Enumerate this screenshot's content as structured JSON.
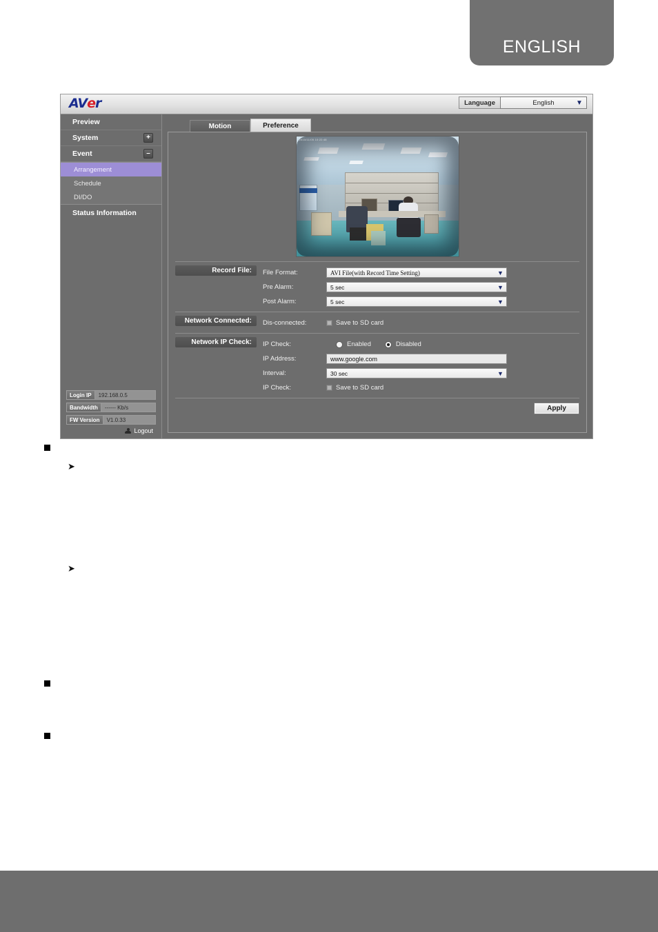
{
  "page": {
    "language_banner": "ENGLISH"
  },
  "app": {
    "logo": {
      "part1": "AV",
      "swirl": "e",
      "part2": "r"
    },
    "language": {
      "label": "Language",
      "selected": "English",
      "caret_icon": "chevron-down-icon"
    }
  },
  "sidebar": {
    "items": [
      {
        "label": "Preview",
        "toggle": ""
      },
      {
        "label": "System",
        "toggle": "+"
      },
      {
        "label": "Event",
        "toggle": "–"
      }
    ],
    "sub_items": [
      {
        "label": "Arrangement",
        "active": true
      },
      {
        "label": "Schedule",
        "active": false
      },
      {
        "label": "DI/DO",
        "active": false
      }
    ],
    "status_nav": {
      "label": "Status Information"
    },
    "status": [
      {
        "key": "Login IP",
        "value": "192.168.0.5"
      },
      {
        "key": "Bandwidth",
        "value": "------ Kb/s"
      },
      {
        "key": "FW Version",
        "value": "V1.0.33"
      }
    ],
    "logout": {
      "label": "Logout",
      "icon": "user-icon"
    }
  },
  "tabs": [
    {
      "label": "Motion",
      "active": false
    },
    {
      "label": "Preference",
      "active": true
    }
  ],
  "preview": {
    "timestamp_overlay": "2010/11/05 10:22:48"
  },
  "form": {
    "record_file": {
      "group_label": "Record File:",
      "rows": [
        {
          "label": "File Format:",
          "type": "select",
          "value": "AVI File(with Record Time Setting)"
        },
        {
          "label": "Pre Alarm:",
          "type": "select",
          "value": "5 sec"
        },
        {
          "label": "Post Alarm:",
          "type": "select",
          "value": "5 sec"
        }
      ]
    },
    "network_connected": {
      "group_label": "Network Connected:",
      "rows": [
        {
          "label": "Dis-connected:",
          "type": "checkbox",
          "value": "Save to SD card",
          "checked": false
        }
      ]
    },
    "network_ip_check": {
      "group_label": "Network IP Check:",
      "rows": [
        {
          "label": "IP Check:",
          "type": "radio",
          "options": [
            {
              "label": "Enabled",
              "selected": false
            },
            {
              "label": "Disabled",
              "selected": true
            }
          ]
        },
        {
          "label": "IP Address:",
          "type": "text",
          "value": "www.google.com"
        },
        {
          "label": "Interval:",
          "type": "select",
          "value": "30 sec"
        },
        {
          "label": "IP Check:",
          "type": "checkbox",
          "value": "Save to SD card",
          "checked": false
        }
      ]
    },
    "apply_button": "Apply"
  },
  "colors": {
    "accent_purple": "#9d8ed6",
    "panel_gray": "#6d6d6d",
    "banner_gray": "#717171",
    "logo_blue": "#1b2d8f",
    "logo_red": "#d8202a"
  }
}
